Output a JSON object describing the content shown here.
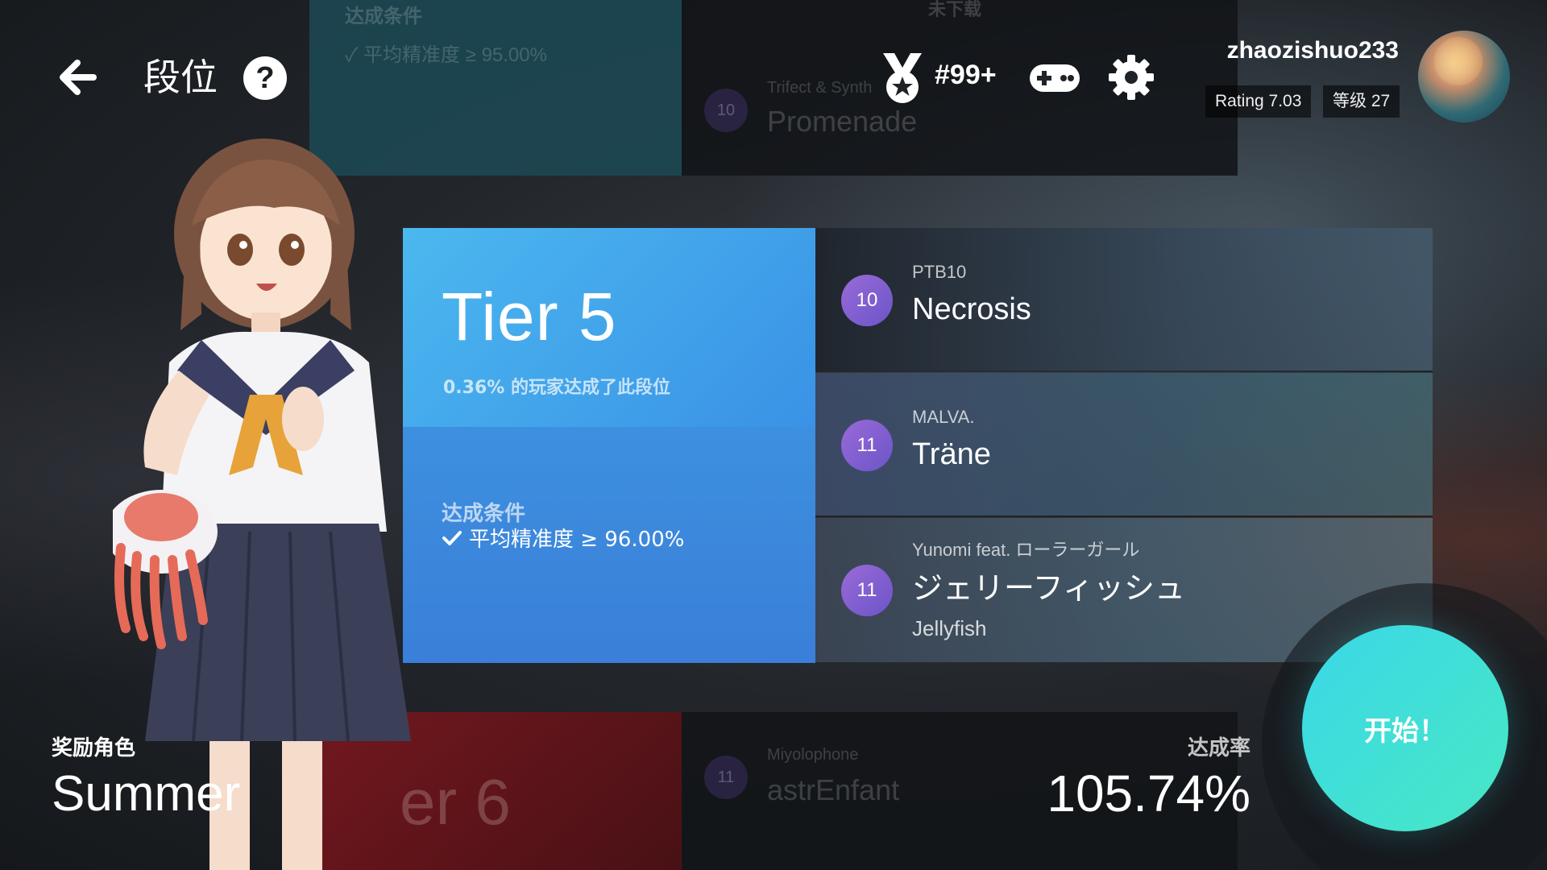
{
  "header": {
    "title": "段位",
    "rank": "#99+",
    "username": "zhaozishuo233",
    "rating": "Rating 7.03",
    "level": "等级 27"
  },
  "ghost_cards": {
    "top_left_title": "达成条件",
    "top_left_condition": "✓ 平均精准度 ≥ 95.00%",
    "top_right_status": "未下载",
    "top_right_artist": "Trifect & Synth",
    "top_right_song": "Promenade",
    "top_right_level": "10",
    "bottom_left_tier": "er 6",
    "bottom_right_artist": "Miyolophone",
    "bottom_right_song": "astrEnfant",
    "bottom_right_level": "11"
  },
  "tier": {
    "name": "Tier 5",
    "percentage": "0.36% 的玩家达成了此段位",
    "condition_title": "达成条件",
    "condition": "平均精准度 ≥ 96.00%"
  },
  "songs": [
    {
      "level": "10",
      "artist": "PTB10",
      "title": "Necrosis",
      "subtitle": ""
    },
    {
      "level": "11",
      "artist": "MALVA.",
      "title": "Träne",
      "subtitle": ""
    },
    {
      "level": "11",
      "artist": "Yunomi feat. ローラーガール",
      "title": "ジェリーフィッシュ",
      "subtitle": "Jellyfish"
    }
  ],
  "reward": {
    "label": "奖励角色",
    "name": "Summer"
  },
  "achievement": {
    "label": "达成率",
    "value": "105.74%"
  },
  "start_button": "开始！",
  "colors": {
    "tier_card_top": "#4bb8ef",
    "tier_card_bottom": "#3a7fd9",
    "level_badge": "#7b5fd0",
    "start_button": "#3ad8e8"
  },
  "icons": [
    "back-arrow-icon",
    "help-icon",
    "medal-icon",
    "gamepad-icon",
    "gear-icon",
    "check-icon"
  ]
}
